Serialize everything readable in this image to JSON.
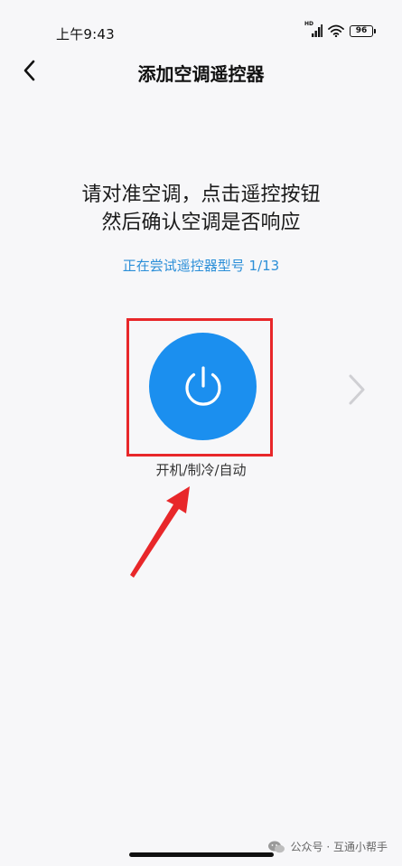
{
  "status_bar": {
    "time": "上午9:43",
    "network_label": "HD",
    "battery": "96"
  },
  "nav": {
    "title": "添加空调遥控器"
  },
  "main": {
    "instruction_line1": "请对准空调，点击遥控按钮",
    "instruction_line2": "然后确认空调是否响应",
    "trying_model": "正在尝试遥控器型号 1/13",
    "power_button_label": "开机/制冷/自动"
  },
  "watermark": {
    "text": "公众号 · 互通小帮手"
  },
  "colors": {
    "accent": "#1b8fef",
    "link": "#2c8fd8",
    "highlight": "#e8272a",
    "background": "#f7f7f9"
  },
  "icons": [
    "back-chevron-icon",
    "power-icon",
    "chevron-right-icon",
    "signal-icon",
    "wifi-icon",
    "battery-icon",
    "wechat-icon"
  ]
}
